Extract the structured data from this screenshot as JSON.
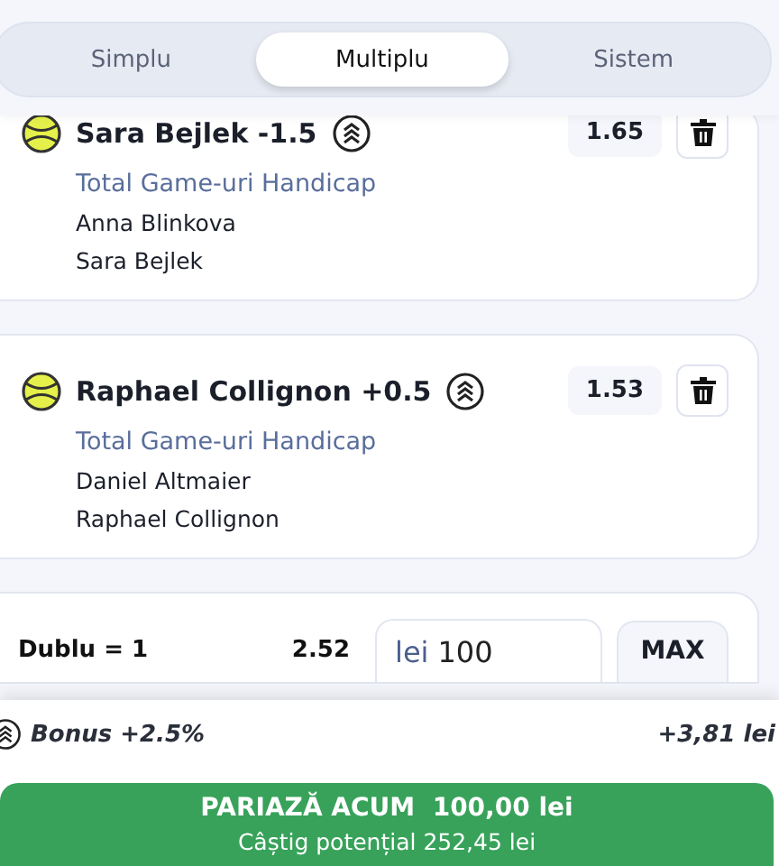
{
  "tabs": [
    {
      "label": "Simplu",
      "selected": false
    },
    {
      "label": "Multiplu",
      "selected": true
    },
    {
      "label": "Sistem",
      "selected": false
    }
  ],
  "selections": [
    {
      "title": "Sara Bejlek -1.5",
      "odds": "1.65",
      "market": "Total Game-uri Handicap",
      "players": [
        "Anna Blinkova",
        "Sara Bejlek"
      ]
    },
    {
      "title": "Raphael Collignon +0.5",
      "odds": "1.53",
      "market": "Total Game-uri Handicap",
      "players": [
        "Daniel Altmaier",
        "Raphael Collignon"
      ]
    }
  ],
  "stake": {
    "label": "Dublu = 1",
    "odds": "2.52",
    "currency": "lei",
    "value": "100",
    "max_button": "MAX"
  },
  "bonus": {
    "label": "Bonus +2.5%",
    "amount": "+3,81 lei"
  },
  "place_bet": {
    "label": "PARIAZĂ ACUM  100,00 lei",
    "potential": "Câștig potențial 252,45 lei"
  }
}
